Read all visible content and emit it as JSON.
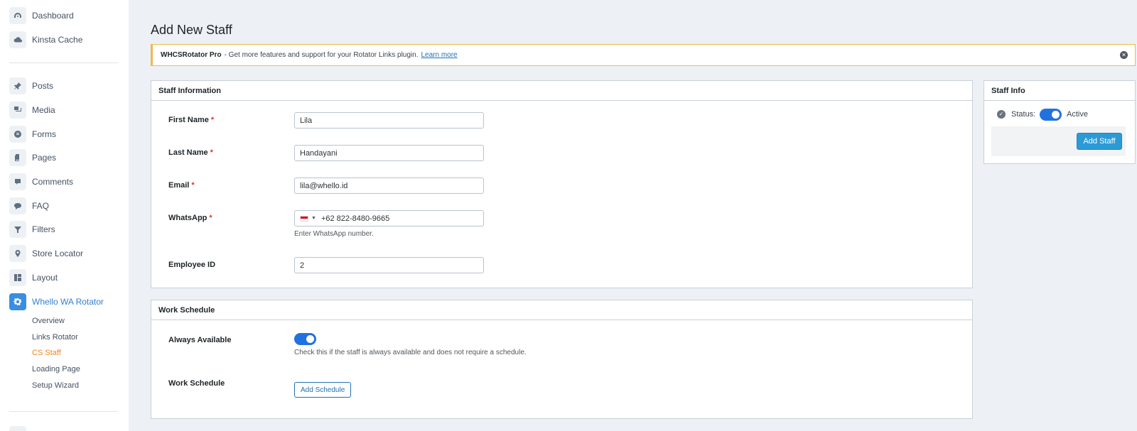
{
  "sidebar": {
    "top_items": [
      {
        "label": "Dashboard",
        "icon": "dashboard-icon"
      },
      {
        "label": "Kinsta Cache",
        "icon": "cloud-icon"
      }
    ],
    "items": [
      {
        "label": "Posts",
        "icon": "pin-icon"
      },
      {
        "label": "Media",
        "icon": "media-icon"
      },
      {
        "label": "Forms",
        "icon": "forms-icon"
      },
      {
        "label": "Pages",
        "icon": "pages-icon"
      },
      {
        "label": "Comments",
        "icon": "comment-icon"
      },
      {
        "label": "FAQ",
        "icon": "faq-icon"
      },
      {
        "label": "Filters",
        "icon": "filter-icon"
      },
      {
        "label": "Store Locator",
        "icon": "location-pin-icon"
      },
      {
        "label": "Layout",
        "icon": "layout-icon"
      },
      {
        "label": "Whello WA Rotator",
        "icon": "gear-icon"
      }
    ],
    "sub_items": [
      {
        "label": "Overview"
      },
      {
        "label": "Links Rotator"
      },
      {
        "label": "CS Staff"
      },
      {
        "label": "Loading Page"
      },
      {
        "label": "Setup Wizard"
      }
    ]
  },
  "page": {
    "title": "Add New Staff"
  },
  "notice": {
    "brand": "WHCSRotator Pro",
    "message": "- Get more features and support for your Rotator Links plugin.",
    "link": "Learn more"
  },
  "staff_info_panel": {
    "title": "Staff Information",
    "fields": {
      "first_name": {
        "label": "First Name",
        "value": "Lila"
      },
      "last_name": {
        "label": "Last Name",
        "value": "Handayani"
      },
      "email": {
        "label": "Email",
        "value": "lila@whello.id"
      },
      "whatsapp": {
        "label": "WhatsApp",
        "value": "+62 822-8480-9665",
        "help": "Enter WhatsApp number."
      },
      "employee_id": {
        "label": "Employee ID",
        "value": "2"
      }
    },
    "required_mark": "*"
  },
  "work_schedule_panel": {
    "title": "Work Schedule",
    "always_available": {
      "label": "Always Available",
      "checked": true,
      "help": "Check this if the staff is always available and does not require a schedule."
    },
    "work_schedule": {
      "label": "Work Schedule",
      "button": "Add Schedule"
    }
  },
  "side_panel": {
    "title": "Staff Info",
    "status_label": "Status:",
    "status_value": "Active",
    "status_on": true,
    "submit_button": "Add Staff"
  },
  "colors": {
    "accent": "#2271e0",
    "current_submenu": "#f0861c",
    "notice_border": "#f0b849",
    "required": "#d63638"
  }
}
